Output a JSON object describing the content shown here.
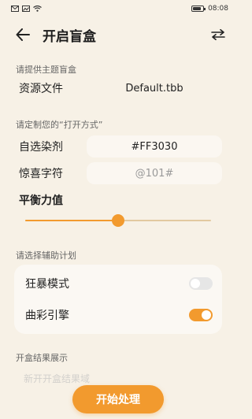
{
  "status_bar": {
    "time": "08:08",
    "left_icons": [
      "envelope-icon",
      "image-icon",
      "wifi-icon"
    ],
    "right_icons": [
      "battery-icon"
    ]
  },
  "header": {
    "title": "开启盲盒",
    "back_icon": "arrow-left-icon",
    "action_icon": "swap-icon"
  },
  "sections": {
    "theme": "请提供主题盲盒",
    "custom": "请定制您的“打开方式”",
    "assist": "请选择辅助计划",
    "result": "开盒结果展示"
  },
  "resource": {
    "label": "资源文件",
    "value": "Default.tbb"
  },
  "dye": {
    "label": "自选染剂",
    "value": "#FF3030"
  },
  "surprise": {
    "label": "惊喜字符",
    "placeholder": "@101#"
  },
  "balance": {
    "label": "平衡力值",
    "value": 0.5
  },
  "assist_options": [
    {
      "label": "狂暴模式",
      "enabled": false
    },
    {
      "label": "曲彩引擎",
      "enabled": true
    }
  ],
  "result_preview": "新开开盒结果域",
  "start_button": "开始处理",
  "colors": {
    "accent": "#f29a2e",
    "background": "#f7f1e6"
  }
}
